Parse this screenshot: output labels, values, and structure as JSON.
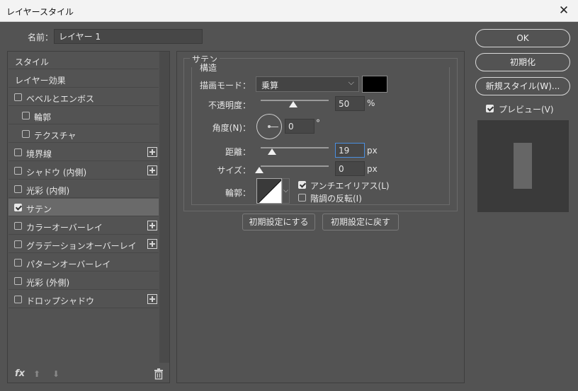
{
  "window": {
    "title": "レイヤースタイル",
    "close_glyph": "✕"
  },
  "name_field": {
    "label": "名前：",
    "value": "レイヤー 1"
  },
  "styles_list": {
    "items": [
      {
        "label": "スタイル",
        "checkbox": false,
        "checked": false,
        "plus": false,
        "indent": false,
        "selected": false
      },
      {
        "label": "レイヤー効果",
        "checkbox": false,
        "checked": false,
        "plus": false,
        "indent": false,
        "selected": false
      },
      {
        "label": "ベベルとエンボス",
        "checkbox": true,
        "checked": false,
        "plus": false,
        "indent": false,
        "selected": false
      },
      {
        "label": "輪郭",
        "checkbox": true,
        "checked": false,
        "plus": false,
        "indent": true,
        "selected": false
      },
      {
        "label": "テクスチャ",
        "checkbox": true,
        "checked": false,
        "plus": false,
        "indent": true,
        "selected": false
      },
      {
        "label": "境界線",
        "checkbox": true,
        "checked": false,
        "plus": true,
        "indent": false,
        "selected": false
      },
      {
        "label": "シャドウ (内側)",
        "checkbox": true,
        "checked": false,
        "plus": true,
        "indent": false,
        "selected": false
      },
      {
        "label": "光彩 (内側)",
        "checkbox": true,
        "checked": false,
        "plus": false,
        "indent": false,
        "selected": false
      },
      {
        "label": "サテン",
        "checkbox": true,
        "checked": true,
        "plus": false,
        "indent": false,
        "selected": true
      },
      {
        "label": "カラーオーバーレイ",
        "checkbox": true,
        "checked": false,
        "plus": true,
        "indent": false,
        "selected": false
      },
      {
        "label": "グラデーションオーバーレイ",
        "checkbox": true,
        "checked": false,
        "plus": true,
        "indent": false,
        "selected": false
      },
      {
        "label": "パターンオーバーレイ",
        "checkbox": true,
        "checked": false,
        "plus": false,
        "indent": false,
        "selected": false
      },
      {
        "label": "光彩 (外側)",
        "checkbox": true,
        "checked": false,
        "plus": false,
        "indent": false,
        "selected": false
      },
      {
        "label": "ドロップシャドウ",
        "checkbox": true,
        "checked": false,
        "plus": true,
        "indent": false,
        "selected": false
      }
    ],
    "tools": {
      "fx": "fx",
      "up": "⬆",
      "down": "⬇"
    }
  },
  "satin": {
    "legend": "サテン",
    "sub_legend": "構造",
    "blend_mode": {
      "label": "描画モード：",
      "value": "乗算",
      "chevron": "⌵",
      "color": "#000000"
    },
    "opacity": {
      "label": "不透明度：",
      "value": "50",
      "unit": "%",
      "slider_fraction": 0.5
    },
    "angle": {
      "label": "角度(N)：",
      "value": "0",
      "unit": "°"
    },
    "distance": {
      "label": "距離：",
      "value": "19",
      "unit": "px",
      "slider_fraction": 0.13
    },
    "size": {
      "label": "サイズ：",
      "value": "0",
      "unit": "px",
      "slider_fraction": 0.0
    },
    "contour": {
      "label": "輪郭：",
      "dropdown": "⌵"
    },
    "antialias": {
      "label": "アンチエイリアス(L)",
      "checked": true
    },
    "invert": {
      "label": "階調の反転(I)",
      "checked": false
    },
    "buttons": {
      "make_default": "初期設定にする",
      "reset_default": "初期設定に戻す"
    }
  },
  "right_panel": {
    "ok": "OK",
    "reset": "初期化",
    "new_style": "新規スタイル(W)...",
    "preview": {
      "label": "プレビュー(V)",
      "checked": true
    }
  }
}
